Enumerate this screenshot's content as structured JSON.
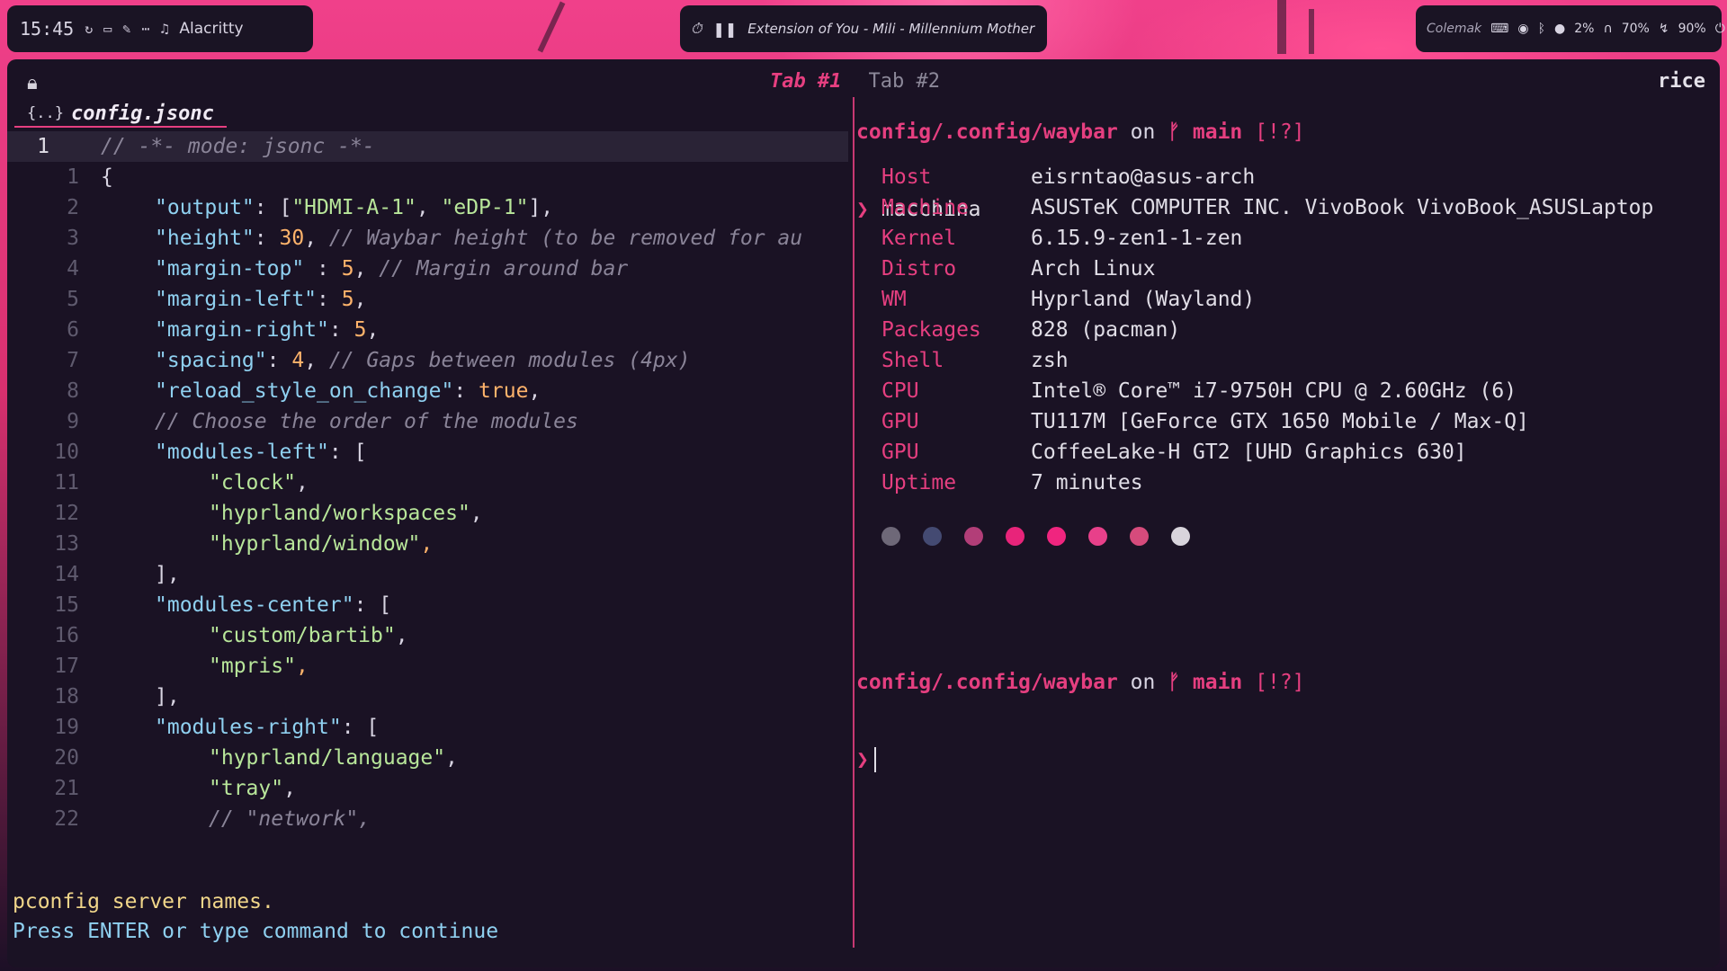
{
  "topbar": {
    "time": "15:45",
    "left_icons": [
      "refresh-icon",
      "window-icon",
      "pen-icon",
      "dots-icon",
      "music-note-icon"
    ],
    "app_name": "Alacritty",
    "media": "Extension of You - Mili - Millennium Mother",
    "keyboard_layout": "Colemak",
    "cpu": "2%",
    "headphones": "70%",
    "battery": "90%"
  },
  "terminal": {
    "tabs": [
      "Tab #1",
      "Tab #2"
    ],
    "session": "rice"
  },
  "editor": {
    "buffer_name": "config.jsonc",
    "buffer_icon": "{..}",
    "current_line_number": "1",
    "lines": [
      {
        "ln": "1",
        "text": "// -*- mode: jsonc -*-"
      },
      {
        "ln": "1",
        "text": "{"
      },
      {
        "ln": "2",
        "text": "\"output\": [\"HDMI-A-1\", \"eDP-1\"],"
      },
      {
        "ln": "3",
        "text": "\"height\": 30, // Waybar height (to be removed for au"
      },
      {
        "ln": "4",
        "text": "\"margin-top\" : 5, // Margin around bar"
      },
      {
        "ln": "5",
        "text": "\"margin-left\": 5,"
      },
      {
        "ln": "6",
        "text": "\"margin-right\": 5,"
      },
      {
        "ln": "7",
        "text": "\"spacing\": 4, // Gaps between modules (4px)"
      },
      {
        "ln": "8",
        "text": "\"reload_style_on_change\": true,"
      },
      {
        "ln": "9",
        "text": "// Choose the order of the modules"
      },
      {
        "ln": "10",
        "text": "\"modules-left\": ["
      },
      {
        "ln": "11",
        "text": "\"clock\","
      },
      {
        "ln": "12",
        "text": "\"hyprland/workspaces\","
      },
      {
        "ln": "13",
        "text": "\"hyprland/window\","
      },
      {
        "ln": "14",
        "text": "],"
      },
      {
        "ln": "15",
        "text": "\"modules-center\": ["
      },
      {
        "ln": "16",
        "text": "\"custom/bartib\","
      },
      {
        "ln": "17",
        "text": "\"mpris\","
      },
      {
        "ln": "18",
        "text": "],"
      },
      {
        "ln": "19",
        "text": "\"modules-right\": ["
      },
      {
        "ln": "20",
        "text": "\"hyprland/language\","
      },
      {
        "ln": "21",
        "text": "\"tray\","
      },
      {
        "ln": "22",
        "text": "// \"network\","
      }
    ],
    "message_line1": "pconfig server names.",
    "message_line2": "Press ENTER or type command to continue"
  },
  "shell": {
    "cwd": "config/.config/waybar",
    "on": "on",
    "branch_symbol": "ᚠ",
    "branch": "main",
    "git_status": "[!?]",
    "prompt_char": "❯",
    "command": "macchina",
    "info": [
      {
        "key": "Host",
        "value": "eisrntao@asus-arch"
      },
      {
        "key": "Machine",
        "value": "ASUSTeK COMPUTER INC. VivoBook VivoBook_ASUSLaptop"
      },
      {
        "key": "Kernel",
        "value": "6.15.9-zen1-1-zen"
      },
      {
        "key": "Distro",
        "value": "Arch Linux"
      },
      {
        "key": "WM",
        "value": "Hyprland (Wayland)"
      },
      {
        "key": "Packages",
        "value": "828 (pacman)"
      },
      {
        "key": "Shell",
        "value": "zsh"
      },
      {
        "key": "CPU",
        "value": "Intel® Core™ i7-9750H CPU @ 2.60GHz (6)"
      },
      {
        "key": "GPU",
        "value": "TU117M [GeForce GTX 1650 Mobile / Max-Q]"
      },
      {
        "key": "GPU",
        "value": "CoffeeLake-H GT2 [UHD Graphics 630]"
      },
      {
        "key": "Uptime",
        "value": "7 minutes"
      }
    ],
    "palette": [
      "#6e6878",
      "#444a72",
      "#b23e78",
      "#e8247a",
      "#f0257f",
      "#e8408a",
      "#d64b7c",
      "#d8d4dc"
    ]
  }
}
